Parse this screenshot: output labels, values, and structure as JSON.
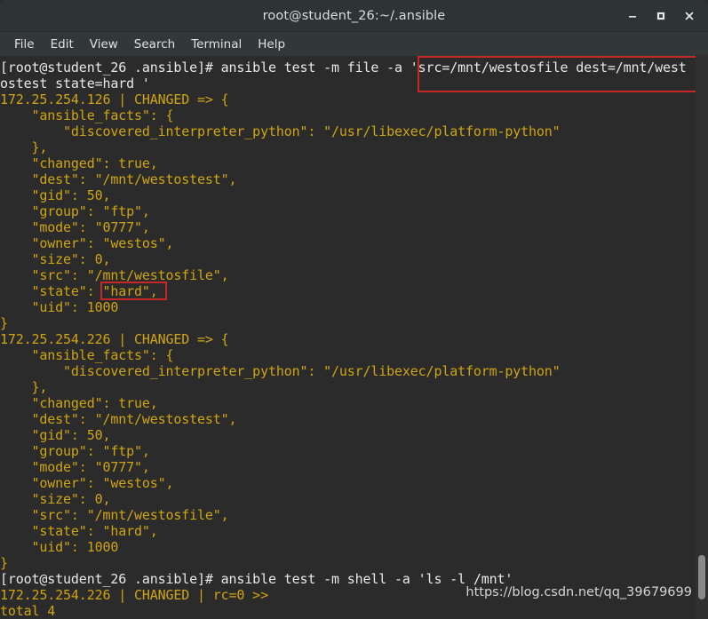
{
  "window": {
    "title": "root@student_26:~/.ansible",
    "controls": [
      {
        "name": "minimize",
        "glyph": "–"
      },
      {
        "name": "maximize",
        "glyph": "□"
      },
      {
        "name": "close",
        "glyph": "✕"
      }
    ]
  },
  "menubar": {
    "items": [
      "File",
      "Edit",
      "View",
      "Search",
      "Terminal",
      "Help"
    ]
  },
  "terminal": {
    "lines": [
      {
        "text": "[root@student_26 .ansible]# ansible test -m file -a 'src=/mnt/westosfile dest=/mnt/west",
        "kind": "prompt"
      },
      {
        "text": "ostest state=hard '",
        "kind": "prompt"
      },
      {
        "text": "172.25.254.126 | CHANGED => {",
        "kind": "out"
      },
      {
        "text": "    \"ansible_facts\": {",
        "kind": "out"
      },
      {
        "text": "        \"discovered_interpreter_python\": \"/usr/libexec/platform-python\"",
        "kind": "out"
      },
      {
        "text": "    },",
        "kind": "out"
      },
      {
        "text": "    \"changed\": true,",
        "kind": "out"
      },
      {
        "text": "    \"dest\": \"/mnt/westostest\",",
        "kind": "out"
      },
      {
        "text": "    \"gid\": 50,",
        "kind": "out"
      },
      {
        "text": "    \"group\": \"ftp\",",
        "kind": "out"
      },
      {
        "text": "    \"mode\": \"0777\",",
        "kind": "out"
      },
      {
        "text": "    \"owner\": \"westos\",",
        "kind": "out"
      },
      {
        "text": "    \"size\": 0,",
        "kind": "out"
      },
      {
        "text": "    \"src\": \"/mnt/westosfile\",",
        "kind": "out"
      },
      {
        "text": "    \"state\": \"hard\",",
        "kind": "out"
      },
      {
        "text": "    \"uid\": 1000",
        "kind": "out"
      },
      {
        "text": "}",
        "kind": "out"
      },
      {
        "text": "172.25.254.226 | CHANGED => {",
        "kind": "out"
      },
      {
        "text": "    \"ansible_facts\": {",
        "kind": "out"
      },
      {
        "text": "        \"discovered_interpreter_python\": \"/usr/libexec/platform-python\"",
        "kind": "out"
      },
      {
        "text": "    },",
        "kind": "out"
      },
      {
        "text": "    \"changed\": true,",
        "kind": "out"
      },
      {
        "text": "    \"dest\": \"/mnt/westostest\",",
        "kind": "out"
      },
      {
        "text": "    \"gid\": 50,",
        "kind": "out"
      },
      {
        "text": "    \"group\": \"ftp\",",
        "kind": "out"
      },
      {
        "text": "    \"mode\": \"0777\",",
        "kind": "out"
      },
      {
        "text": "    \"owner\": \"westos\",",
        "kind": "out"
      },
      {
        "text": "    \"size\": 0,",
        "kind": "out"
      },
      {
        "text": "    \"src\": \"/mnt/westosfile\",",
        "kind": "out"
      },
      {
        "text": "    \"state\": \"hard\",",
        "kind": "out"
      },
      {
        "text": "    \"uid\": 1000",
        "kind": "out"
      },
      {
        "text": "}",
        "kind": "out"
      },
      {
        "text": "[root@student_26 .ansible]# ansible test -m shell -a 'ls -l /mnt'",
        "kind": "prompt"
      },
      {
        "text": "172.25.254.226 | CHANGED | rc=0 >>",
        "kind": "out"
      },
      {
        "text": "total 4",
        "kind": "out"
      }
    ]
  },
  "annotations": {
    "command_args_box": "'src=/mnt/westosfile dest=/mnt/westostest state=hard '",
    "state_value_box": "\"hard\","
  },
  "watermark": {
    "text": "https://blog.csdn.net/qq_39679699"
  },
  "colors": {
    "terminal_background": "#2b2b2b",
    "titlebar_background": "#2e3436",
    "menubar_background": "#323738",
    "prompt_text": "#e8e8e8",
    "output_text": "#cfa512",
    "annotation_red": "#c62828",
    "scrollbar_thumb": "#8a8a8a"
  }
}
